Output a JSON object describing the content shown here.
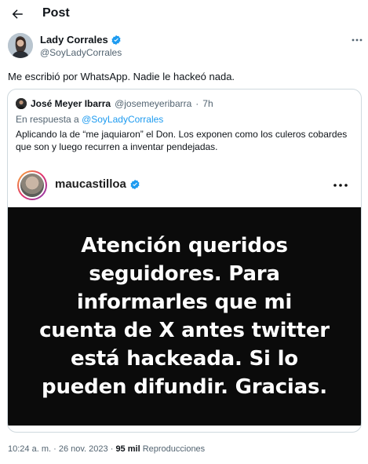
{
  "header": {
    "title": "Post"
  },
  "author": {
    "name": "Lady Corrales",
    "handle": "@SoyLadyCorrales"
  },
  "tweet": {
    "text": "Me escribió por WhatsApp. Nadie le hackeó nada."
  },
  "quote": {
    "name": "José Meyer Ibarra",
    "handle": "@josemeyeribarra",
    "separator": "·",
    "time": "7h",
    "reply_prefix": "En respuesta a",
    "reply_to": "@SoyLadyCorrales",
    "text": "Aplicando la de “me jaquiaron” el Don. Los exponen como los culeros cobardes que son y luego recurren a inventar pendejadas.",
    "instagram": {
      "username": "maucastilloa",
      "image_text": "Atención queridos\nseguidores. Para\ninformarles que mi\ncuenta de X antes twitter\nestá hackeada. Si lo\npueden difundir. Gracias."
    }
  },
  "footer": {
    "time": "10:24 a. m.",
    "separator1": "·",
    "date": "26 nov. 2023",
    "separator2": "·",
    "views_count": "95 mil",
    "views_label": "Reproducciones"
  },
  "icons": {
    "back": "arrow-left-icon",
    "verified": "verified-badge-icon",
    "more": "more-horizontal-icon"
  },
  "colors": {
    "accent": "#1d9bf0",
    "secondary_text": "#536471",
    "border": "#cfd9de"
  }
}
